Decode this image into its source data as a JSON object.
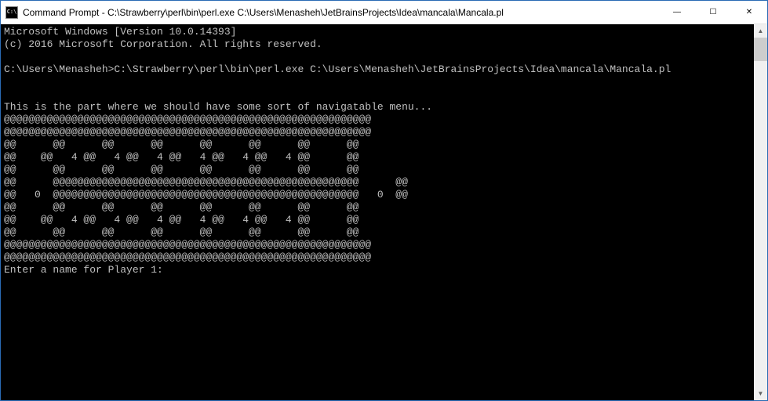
{
  "window": {
    "icon_text": "C:\\",
    "title": "Command Prompt - C:\\Strawberry\\perl\\bin\\perl.exe  C:\\Users\\Menasheh\\JetBrainsProjects\\Idea\\mancala\\Mancala.pl",
    "minimize": "—",
    "maximize": "☐",
    "close": "✕"
  },
  "console": {
    "line1": "Microsoft Windows [Version 10.0.14393]",
    "line2": "(c) 2016 Microsoft Corporation. All rights reserved.",
    "blank1": "",
    "prompt_line": "C:\\Users\\Menasheh>C:\\Strawberry\\perl\\bin\\perl.exe C:\\Users\\Menasheh\\JetBrainsProjects\\Idea\\mancala\\Mancala.pl",
    "blank2": "",
    "blank3": "",
    "menu_line": "This is the part where we should have some sort of navigatable menu...",
    "board01": "@@@@@@@@@@@@@@@@@@@@@@@@@@@@@@@@@@@@@@@@@@@@@@@@@@@@@@@@@@@@",
    "board02": "@@@@@@@@@@@@@@@@@@@@@@@@@@@@@@@@@@@@@@@@@@@@@@@@@@@@@@@@@@@@",
    "board03": "@@      @@      @@      @@      @@      @@      @@      @@",
    "board04": "@@    @@   4 @@   4 @@   4 @@   4 @@   4 @@   4 @@      @@",
    "board05": "@@      @@      @@      @@      @@      @@      @@      @@",
    "board06": "@@      @@@@@@@@@@@@@@@@@@@@@@@@@@@@@@@@@@@@@@@@@@@@@@@@@@      @@",
    "board07": "@@   0  @@@@@@@@@@@@@@@@@@@@@@@@@@@@@@@@@@@@@@@@@@@@@@@@@@   0  @@",
    "board08": "@@      @@      @@      @@      @@      @@      @@      @@",
    "board09": "@@    @@   4 @@   4 @@   4 @@   4 @@   4 @@   4 @@      @@",
    "board10": "@@      @@      @@      @@      @@      @@      @@      @@",
    "board11": "@@@@@@@@@@@@@@@@@@@@@@@@@@@@@@@@@@@@@@@@@@@@@@@@@@@@@@@@@@@@",
    "board12": "@@@@@@@@@@@@@@@@@@@@@@@@@@@@@@@@@@@@@@@@@@@@@@@@@@@@@@@@@@@@",
    "input_prompt": "Enter a name for Player 1: "
  },
  "scrollbar": {
    "up": "▲",
    "down": "▼"
  }
}
